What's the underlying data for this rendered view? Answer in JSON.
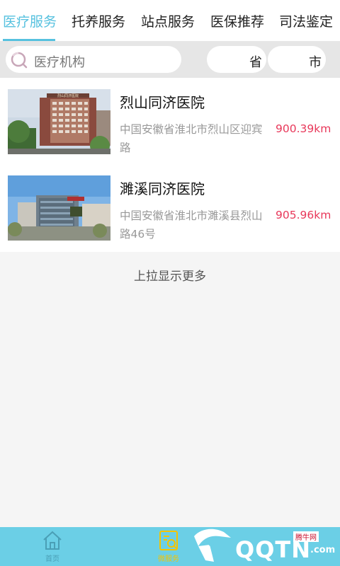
{
  "tabs": [
    {
      "label": "医疗服务",
      "active": true
    },
    {
      "label": "托养服务",
      "active": false
    },
    {
      "label": "站点服务",
      "active": false
    },
    {
      "label": "医保推荐",
      "active": false
    },
    {
      "label": "司法鉴定",
      "active": false
    }
  ],
  "search": {
    "placeholder": "医疗机构",
    "icon": "search-icon"
  },
  "filters": {
    "province_label": "省",
    "city_label": "市"
  },
  "items": [
    {
      "name": "烈山同济医院",
      "address": "中国安徽省淮北市烈山区迎宾路",
      "distance": "900.39km",
      "thumb_sign": "烈山同济医院"
    },
    {
      "name": "濉溪同济医院",
      "address": "中国安徽省淮北市濉溪县烈山路46号",
      "distance": "905.96km",
      "thumb_sign": ""
    }
  ],
  "load_more": "上拉显示更多",
  "bottom_nav": [
    {
      "label": "首页",
      "icon": "home-icon",
      "active": false
    },
    {
      "label": "微服务",
      "icon": "service-icon",
      "active": true
    }
  ],
  "watermark": {
    "text": "QQTN",
    "badge": "腾牛网",
    "suffix": ".com"
  },
  "colors": {
    "accent": "#56c1df",
    "distance": "#e8385a",
    "bottom_bar": "#6bcfe6",
    "active_nav": "#f5c400"
  }
}
